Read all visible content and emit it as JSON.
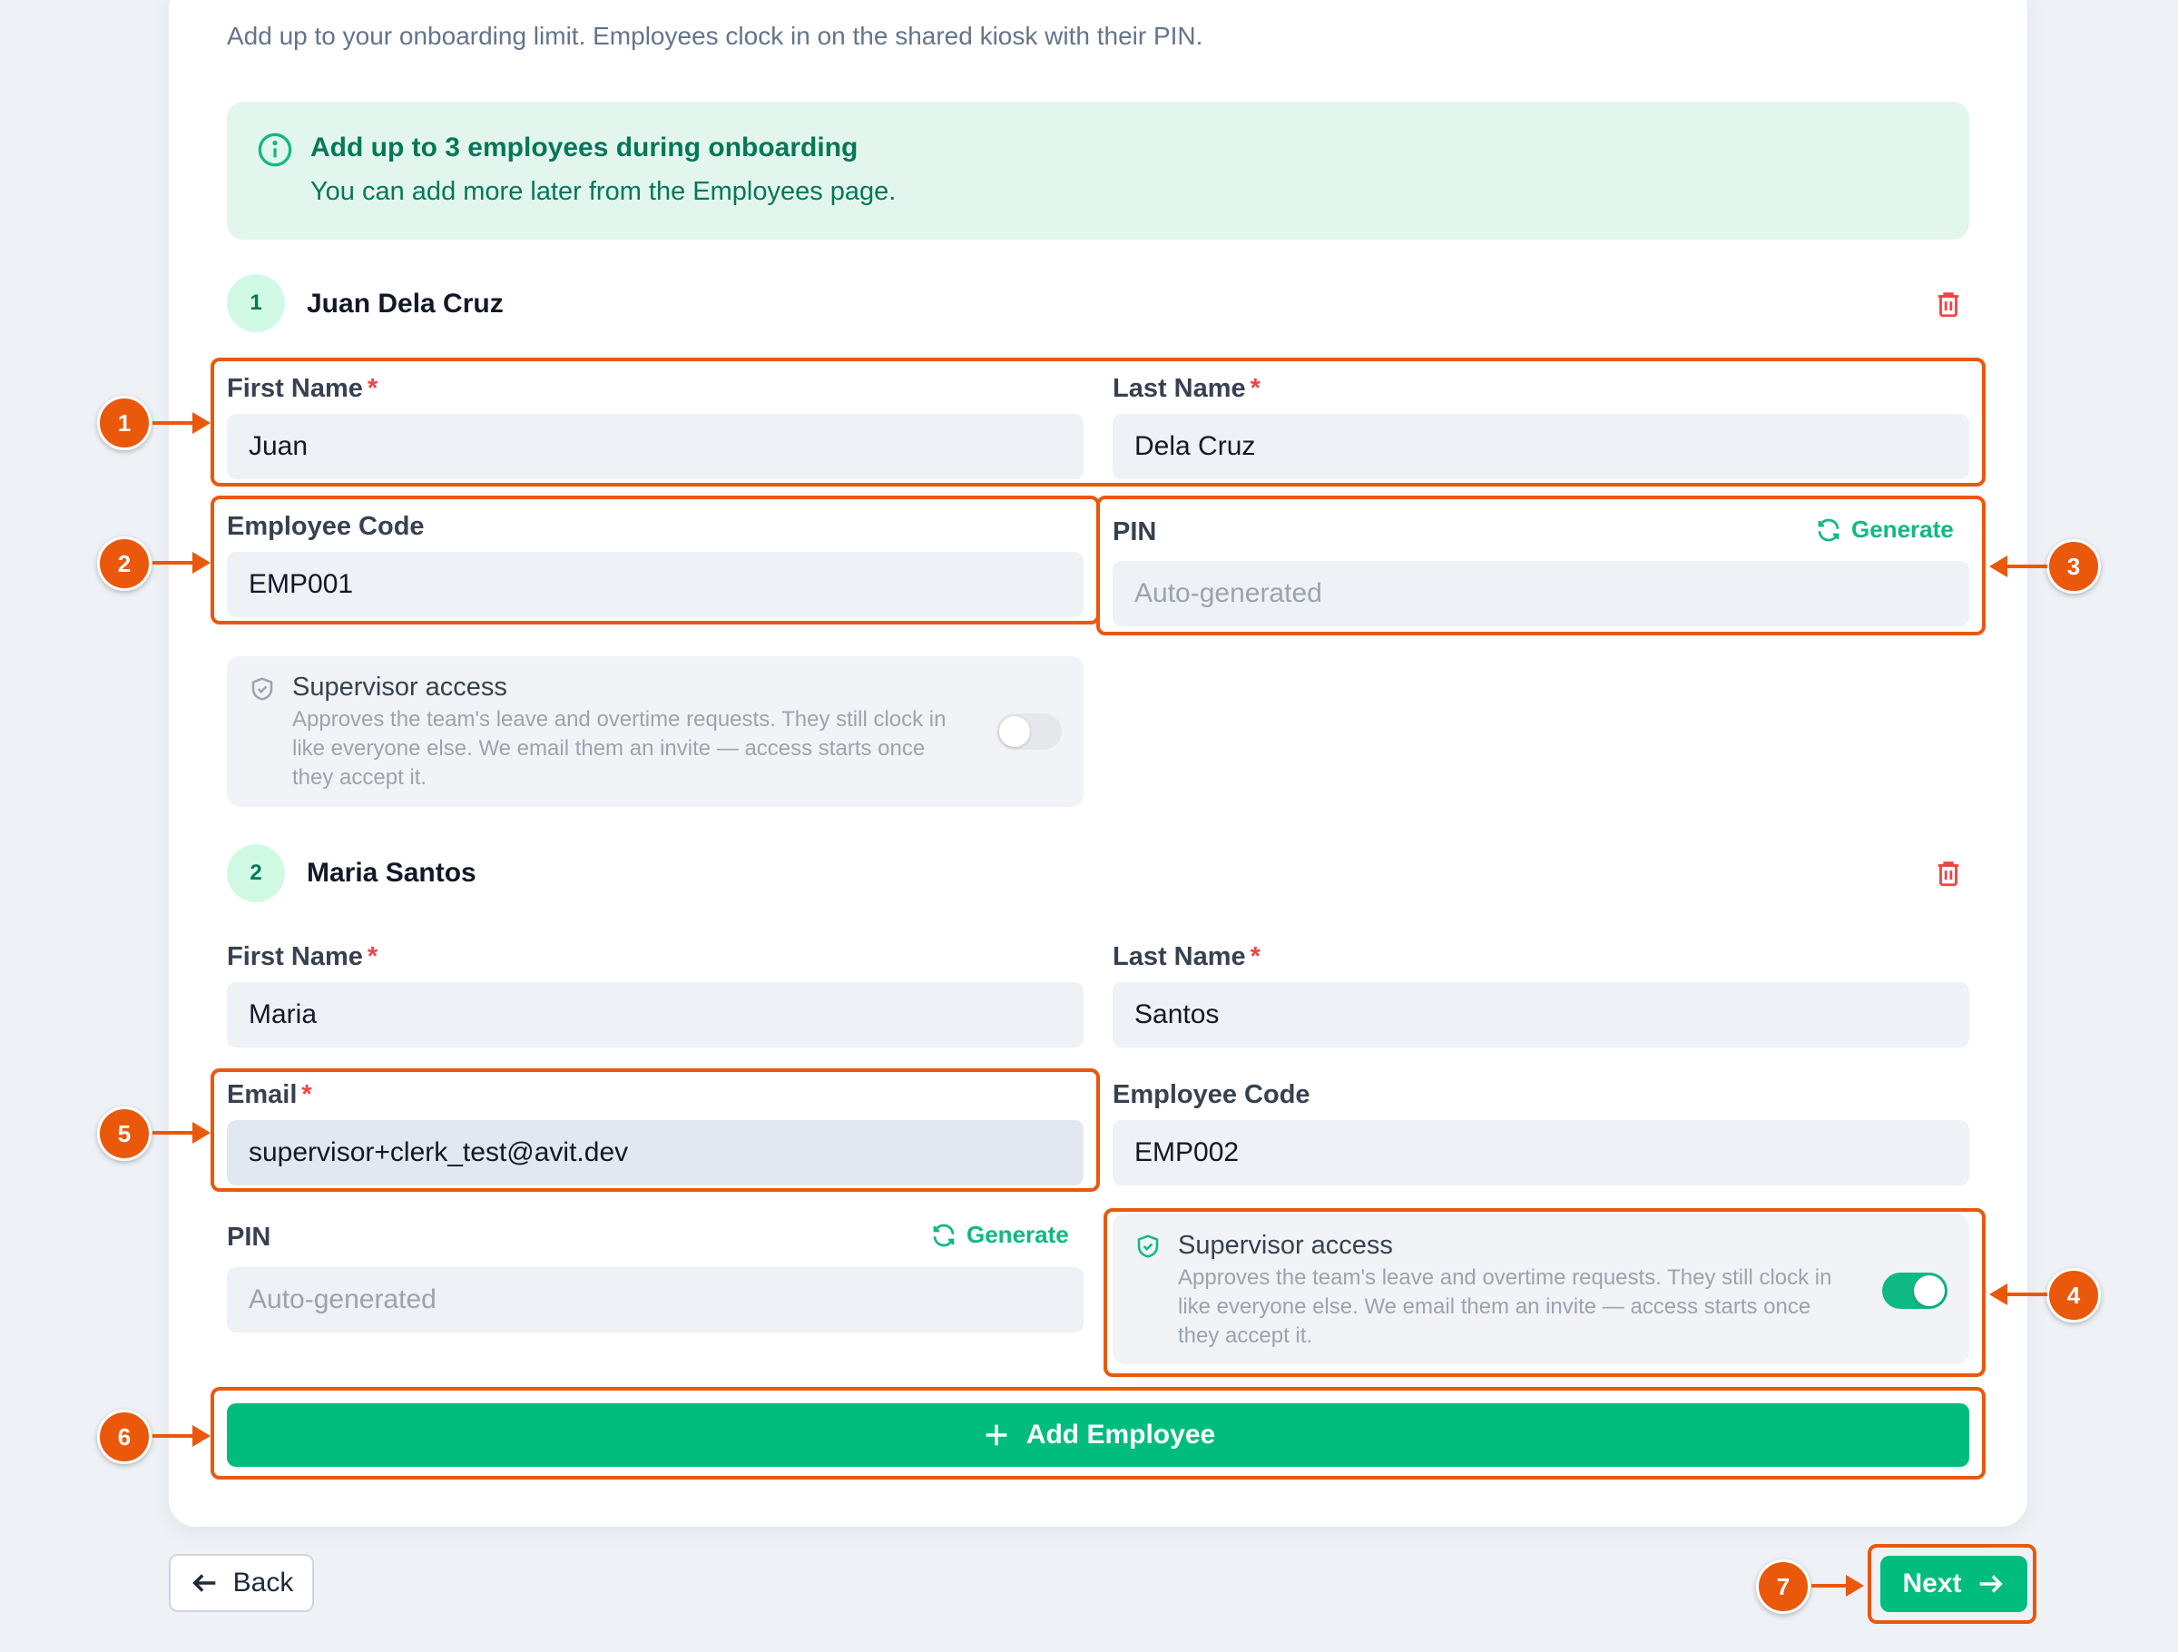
{
  "subtitle": "Add up to your onboarding limit. Employees clock in on the shared kiosk with their PIN.",
  "info": {
    "title": "Add up to 3 employees during onboarding",
    "body": "You can add more later from the Employees page."
  },
  "labels": {
    "first_name": "First Name",
    "last_name": "Last Name",
    "employee_code": "Employee Code",
    "pin": "PIN",
    "email": "Email",
    "required_mark": "*",
    "generate": "Generate",
    "pin_placeholder": "Auto-generated",
    "supervisor_title": "Supervisor access",
    "supervisor_desc": "Approves the team's leave and overtime requests. They still clock in like everyone else. We email them an invite — access starts once they accept it."
  },
  "employees": [
    {
      "number": "1",
      "name": "Juan Dela Cruz",
      "first_name": "Juan",
      "last_name": "Dela Cruz",
      "employee_code": "EMP001",
      "pin": "",
      "supervisor": false
    },
    {
      "number": "2",
      "name": "Maria Santos",
      "first_name": "Maria",
      "last_name": "Santos",
      "email": "supervisor+clerk_test@avit.dev",
      "employee_code": "EMP002",
      "pin": "",
      "supervisor": true
    }
  ],
  "buttons": {
    "add_employee": "Add Employee",
    "back": "Back",
    "next": "Next"
  },
  "callouts": [
    "1",
    "2",
    "3",
    "4",
    "5",
    "6",
    "7"
  ],
  "colors": {
    "accent": "#00bd7e",
    "annotation": "#ea580c",
    "danger": "#ef4444",
    "info_bg": "#e3f6ee"
  }
}
